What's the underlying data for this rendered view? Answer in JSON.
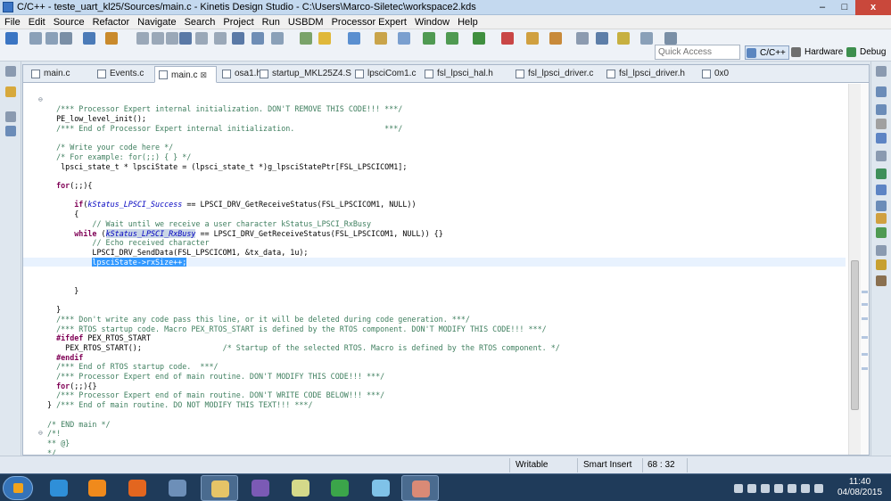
{
  "window": {
    "title": "C/C++ - teste_uart_kl25/Sources/main.c - Kinetis Design Studio - C:\\Users\\Marco-Siletec\\workspace2.kds",
    "min_glyph": "–",
    "max_glyph": "□",
    "close_glyph": "x"
  },
  "menu": [
    "File",
    "Edit",
    "Source",
    "Refactor",
    "Navigate",
    "Search",
    "Project",
    "Run",
    "USBDM",
    "Processor Expert",
    "Window",
    "Help"
  ],
  "toolbar": {
    "quick_access": "Quick Access",
    "perspectives": [
      "C/C++",
      "Hardware",
      "Debug"
    ]
  },
  "tabs": [
    {
      "label": "main.c",
      "icon": "c-file-icon",
      "active": false
    },
    {
      "label": "Events.c",
      "icon": "c-file-icon",
      "active": false
    },
    {
      "label": "main.c",
      "icon": "c-file-icon",
      "active": true
    },
    {
      "label": "osa1.h",
      "icon": "h-file-icon",
      "active": false
    },
    {
      "label": "startup_MKL25Z4.S",
      "icon": "asm-file-icon",
      "active": false
    },
    {
      "label": "lpsciCom1.c",
      "icon": "c-file-icon",
      "active": false
    },
    {
      "label": "fsl_lpsci_hal.h",
      "icon": "h-file-icon",
      "active": false
    },
    {
      "label": "fsl_lpsci_driver.c",
      "icon": "c-file-icon",
      "active": false
    },
    {
      "label": "fsl_lpsci_driver.h",
      "icon": "h-file-icon",
      "active": false
    },
    {
      "label": "0x0",
      "icon": "memory-icon",
      "active": false
    }
  ],
  "tab_close": "⊠",
  "code_lines": [
    [],
    [],
    [
      [
        "c",
        "  /*** Processor Expert internal initialization. DON'T REMOVE THIS CODE!!! ***/"
      ]
    ],
    [
      [
        "",
        "  PE_low_level_init();"
      ]
    ],
    [
      [
        "c",
        "  /*** End of Processor Expert internal initialization.                    ***/"
      ]
    ],
    [],
    [
      [
        "c",
        "  /* Write your code here */"
      ]
    ],
    [
      [
        "c",
        "  /* For example: for(;;) { } */"
      ]
    ],
    [
      [
        "",
        "   lpsci_state_t * lpsciState = (lpsci_state_t *)g_lpsciStatePtr[FSL_LPSCICOM1];"
      ]
    ],
    [],
    [
      [
        "",
        "  "
      ],
      [
        "k",
        "for"
      ],
      [
        "",
        "(;;){"
      ]
    ],
    [],
    [
      [
        "",
        "      "
      ],
      [
        "k",
        "if"
      ],
      [
        "",
        "("
      ],
      [
        "e",
        "kStatus_LPSCI_Success"
      ],
      [
        "",
        " == LPSCI_DRV_GetReceiveStatus(FSL_LPSCICOM1, NULL))"
      ]
    ],
    [
      [
        "",
        "      {"
      ]
    ],
    [
      [
        "c",
        "          // Wait until we receive a user character kStatus_LPSCI_RxBusy"
      ]
    ],
    [
      [
        "",
        "      "
      ],
      [
        "k",
        "while"
      ],
      [
        "",
        " ("
      ],
      [
        "eh",
        "kStatus_LPSCI_RxBusy"
      ],
      [
        "",
        " == LPSCI_DRV_GetReceiveStatus(FSL_LPSCICOM1, NULL)) {}"
      ]
    ],
    [
      [
        "c",
        "          // Echo received character"
      ]
    ],
    [
      [
        "",
        "          LPSCI_DRV_SendData(FSL_LPSCICOM1, &tx_data, 1u);"
      ]
    ],
    [
      [
        "",
        "          "
      ],
      [
        "s",
        "lpsciState->rxSize++;"
      ]
    ],
    [],
    [],
    [
      [
        "",
        "      }"
      ]
    ],
    [],
    [
      [
        "",
        "  }"
      ]
    ],
    [
      [
        "c",
        "  /*** Don't write any code pass this line, or it will be deleted during code generation. ***/"
      ]
    ],
    [
      [
        "c",
        "  /*** RTOS startup code. Macro PEX_RTOS_START is defined by the RTOS component. DON'T MODIFY THIS CODE!!! ***/"
      ]
    ],
    [
      [
        "k",
        "  #ifdef"
      ],
      [
        "",
        " PEX_RTOS_START"
      ]
    ],
    [
      [
        "",
        "    PEX_RTOS_START();                  "
      ],
      [
        "c",
        "/* Startup of the selected RTOS. Macro is defined by the RTOS component. */"
      ]
    ],
    [
      [
        "k",
        "  #endif"
      ]
    ],
    [
      [
        "c",
        "  /*** End of RTOS startup code.  ***/"
      ]
    ],
    [
      [
        "c",
        "  /*** Processor Expert end of main routine. DON'T MODIFY THIS CODE!!! ***/"
      ]
    ],
    [
      [
        "",
        "  "
      ],
      [
        "k",
        "for"
      ],
      [
        "",
        "(;;){}"
      ]
    ],
    [
      [
        "c",
        "  /*** Processor Expert end of main routine. DON'T WRITE CODE BELOW!!! ***/"
      ]
    ],
    [
      [
        "",
        "} "
      ],
      [
        "c",
        "/*** End of main routine. DO NOT MODIFY THIS TEXT!!! ***/"
      ]
    ],
    [],
    [
      [
        "c",
        "/* END main */"
      ]
    ],
    [
      [
        "c",
        "/*!"
      ]
    ],
    [
      [
        "c",
        "** @}"
      ]
    ],
    [
      [
        "c",
        "*/"
      ]
    ]
  ],
  "current_line_index": 18,
  "fold_markers": [
    {
      "line": 1,
      "glyph": "⊖"
    },
    {
      "line": 36,
      "glyph": "⊖"
    }
  ],
  "status": {
    "mode": "Writable",
    "insert": "Smart Insert",
    "position": "68 : 32"
  },
  "clock": {
    "time": "11:40",
    "date": "04/08/2015"
  },
  "taskbar_apps": [
    {
      "name": "internet-explorer",
      "color": "#2f8fd8",
      "running": false
    },
    {
      "name": "media-player",
      "color": "#f08a1c",
      "running": false
    },
    {
      "name": "firefox",
      "color": "#e3661f",
      "running": false
    },
    {
      "name": "thunderbird",
      "color": "#6d8fb8",
      "running": false
    },
    {
      "name": "file-explorer",
      "color": "#e6c467",
      "running": true
    },
    {
      "name": "viber",
      "color": "#7b5ab5",
      "running": false
    },
    {
      "name": "notes-app",
      "color": "#d4d98a",
      "running": false
    },
    {
      "name": "chrome",
      "color": "#3ba54a",
      "running": false
    },
    {
      "name": "kinetis-ide",
      "color": "#7fc2e8",
      "running": false
    },
    {
      "name": "pattern-app",
      "color": "#d98a76",
      "running": true
    }
  ],
  "colors": {
    "comment": "#3f7f5f",
    "keyword": "#7f0055",
    "enum_constant": "#0000c0",
    "selection": "#3399ff",
    "current_line": "#e8f2fe"
  }
}
